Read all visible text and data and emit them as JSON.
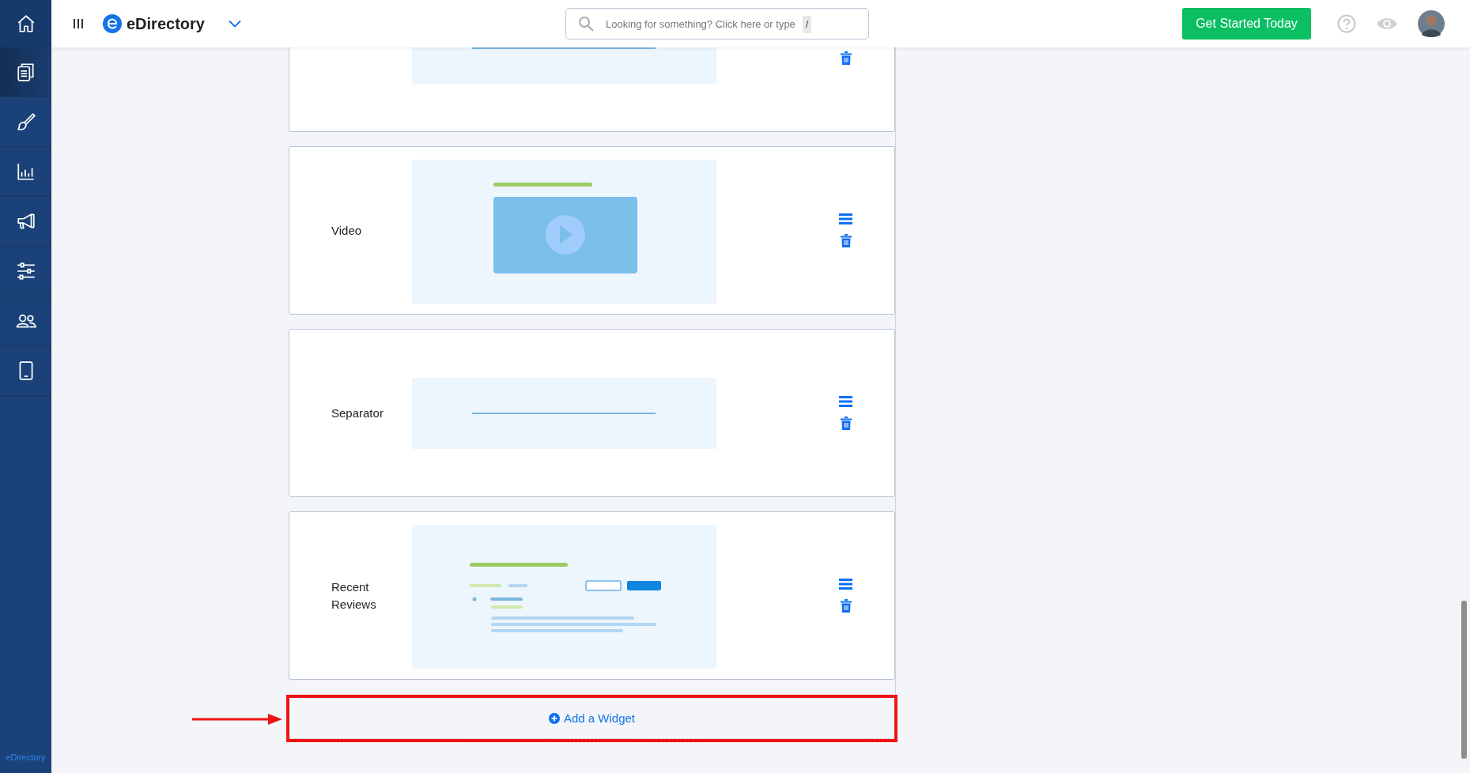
{
  "header": {
    "brand": "eDirectory",
    "search": {
      "placeholder": "Looking for something? Click here or type",
      "shortcut": "/"
    },
    "cta": "Get Started Today"
  },
  "sidebar": {
    "items": [
      {
        "kind": "pages",
        "selected": true
      },
      {
        "kind": "brush",
        "selected": false
      },
      {
        "kind": "chart",
        "selected": false
      },
      {
        "kind": "megaphone",
        "selected": false
      },
      {
        "kind": "sliders",
        "selected": false
      },
      {
        "kind": "users",
        "selected": false
      },
      {
        "kind": "tablet",
        "selected": false
      }
    ],
    "footer": "eDirectory"
  },
  "widgets": [
    {
      "kind": "separator"
    },
    {
      "name": "Video",
      "kind": "video"
    },
    {
      "name": "Separator",
      "kind": "separator"
    },
    {
      "name": "Recent Reviews",
      "kind": "reviews"
    }
  ],
  "add_widget": {
    "label": "Add a Widget",
    "highlighted": true
  }
}
